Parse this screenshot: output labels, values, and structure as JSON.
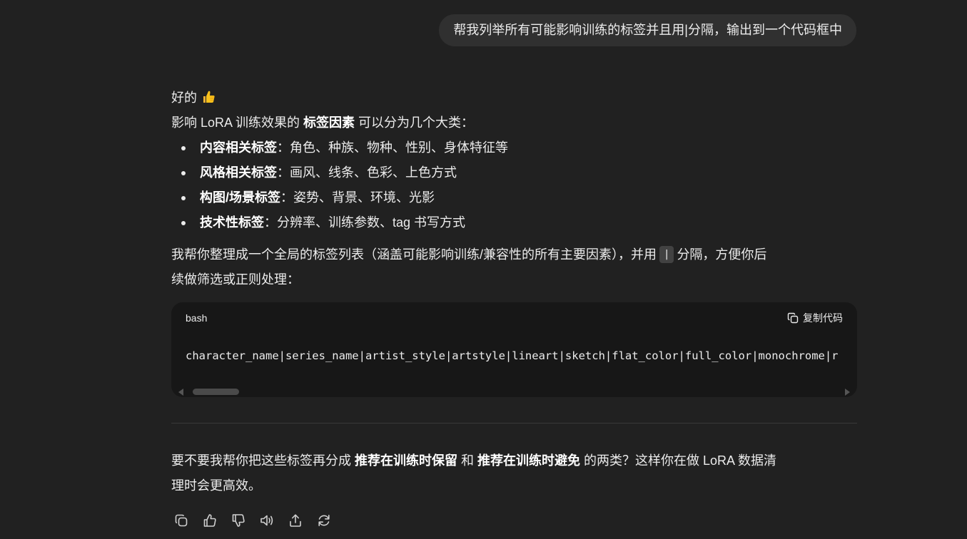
{
  "user_message": "帮我列举所有可能影响训练的标签并且用|分隔，输出到一个代码框中",
  "assistant": {
    "greeting": "好的",
    "greeting_emoji": "thumbs-up-emoji",
    "intro_prefix": "影响 LoRA 训练效果的 ",
    "intro_bold": "标签因素",
    "intro_suffix": " 可以分为几个大类：",
    "categories": [
      {
        "title": "内容相关标签",
        "desc": "：角色、种族、物种、性别、身体特征等"
      },
      {
        "title": "风格相关标签",
        "desc": "：画风、线条、色彩、上色方式"
      },
      {
        "title": "构图/场景标签",
        "desc": "：姿势、背景、环境、光影"
      },
      {
        "title": "技术性标签",
        "desc": "：分辨率、训练参数、tag 书写方式"
      }
    ],
    "summary_line1_prefix": "我帮你整理成一个全局的标签列表（涵盖可能影响训练/兼容性的所有主要因素），并用",
    "summary_inline_code": "|",
    "summary_line1_suffix": "分隔，方便你后",
    "summary_line2": "续做筛选或正则处理：",
    "code_block": {
      "language": "bash",
      "copy_label": "复制代码",
      "content": "character_name|series_name|artist_style|artstyle|lineart|sketch|flat_color|full_color|monochrome|r"
    },
    "followup_line1_prefix": "要不要我帮你把这些标签再分成 ",
    "followup_bold1": "推荐在训练时保留",
    "followup_mid": " 和 ",
    "followup_bold2": "推荐在训练时避免",
    "followup_line1_suffix": " 的两类？这样你在做 LoRA 数据清",
    "followup_line2": "理时会更高效。"
  },
  "actions": [
    "copy-icon",
    "thumbs-up-icon",
    "thumbs-down-icon",
    "read-aloud-icon",
    "share-icon",
    "regenerate-icon"
  ],
  "colors": {
    "background": "#212121",
    "user_bubble": "#303030",
    "code_block": "#171717",
    "text": "#ececec"
  }
}
